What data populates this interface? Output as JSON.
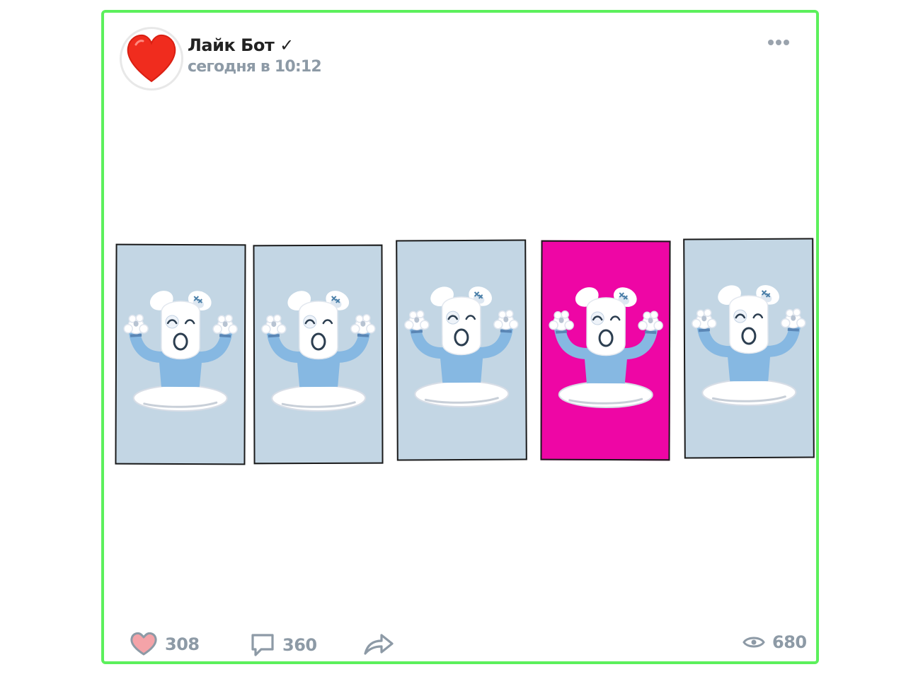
{
  "post": {
    "author": "Лайк Бот ✓",
    "timestamp": "сегодня в 10:12",
    "menu_icon": "more-horizontal-icon"
  },
  "frames": [
    {
      "bg": "#c3d6e4",
      "highlighted": false
    },
    {
      "bg": "#c3d6e4",
      "highlighted": false
    },
    {
      "bg": "#c3d6e4",
      "highlighted": false
    },
    {
      "bg": "#ee06a5",
      "highlighted": true
    },
    {
      "bg": "#c3d6e4",
      "highlighted": false
    }
  ],
  "footer": {
    "likes": "308",
    "comments": "360",
    "views": "680",
    "like_icon": "heart-icon",
    "comment_icon": "comment-icon",
    "share_icon": "share-icon",
    "views_icon": "eye-icon"
  },
  "colors": {
    "border": "#5cf05c",
    "accent_heart": "#f02c1e",
    "muted": "#8d9aa6",
    "frame_default": "#c3d6e4",
    "frame_selected": "#ee06a5"
  }
}
